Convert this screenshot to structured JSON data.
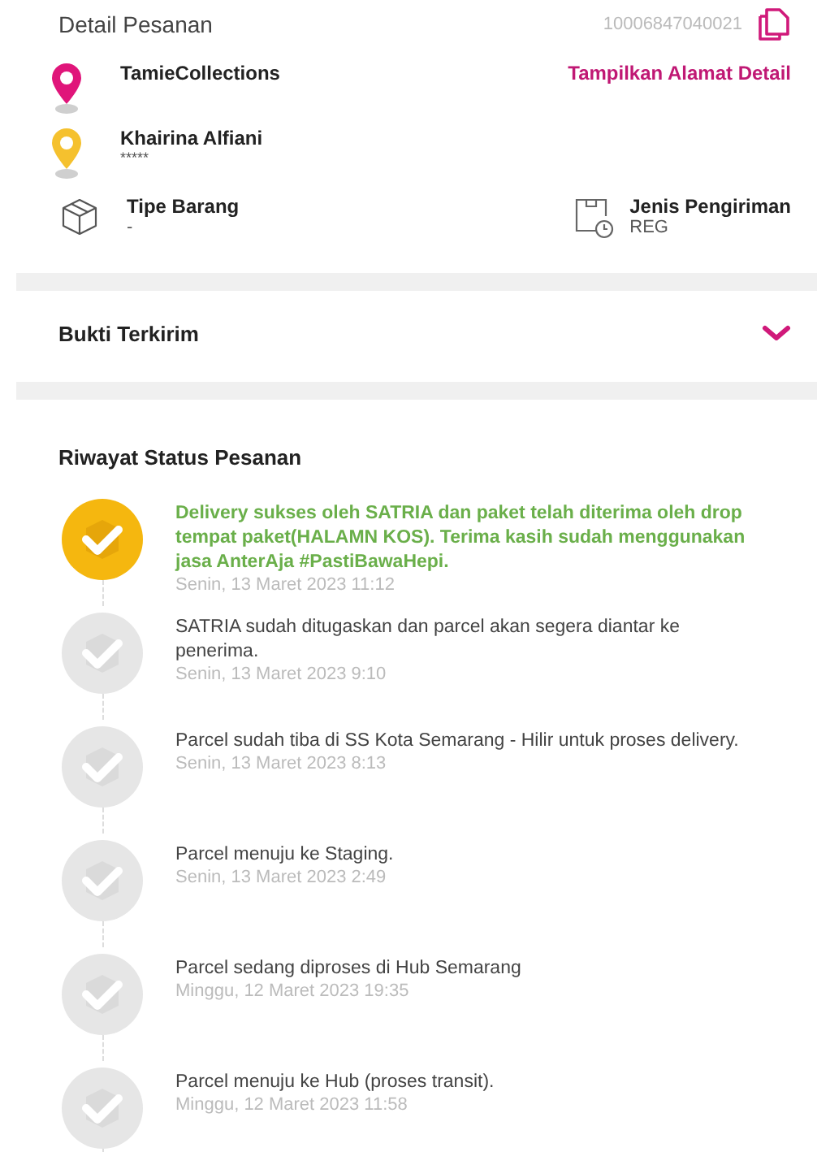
{
  "header": {
    "title": "Detail Pesanan",
    "order_number": "10006847040021"
  },
  "sender": {
    "name": "TamieCollections",
    "link": "Tampilkan Alamat Detail"
  },
  "receiver": {
    "name": "Khairina Alfiani",
    "detail": "*****"
  },
  "item_type": {
    "label": "Tipe Barang",
    "value": "-"
  },
  "shipping_type": {
    "label": "Jenis Pengiriman",
    "value": "REG"
  },
  "proof": {
    "title": "Bukti Terkirim",
    "expanded": false
  },
  "history": {
    "title": "Riwayat Status Pesanan",
    "items": [
      {
        "text": "Delivery sukses oleh SATRIA dan paket telah diterima oleh drop tempat paket(HALAMN KOS). Terima kasih sudah menggunakan jasa AnterAja #PastiBawaHepi.",
        "time": "Senin, 13 Maret 2023 11:12",
        "active": true
      },
      {
        "text": "SATRIA sudah ditugaskan dan parcel akan segera diantar ke penerima.",
        "time": "Senin, 13 Maret 2023 9:10",
        "active": false
      },
      {
        "text": "Parcel sudah tiba di SS Kota Semarang - Hilir untuk proses delivery.",
        "time": "Senin, 13 Maret 2023 8:13",
        "active": false
      },
      {
        "text": "Parcel menuju ke Staging.",
        "time": "Senin, 13 Maret 2023 2:49",
        "active": false
      },
      {
        "text": "Parcel sedang diproses di Hub Semarang",
        "time": "Minggu, 12 Maret 2023 19:35",
        "active": false
      },
      {
        "text": "Parcel menuju ke Hub (proses transit).",
        "time": "Minggu, 12 Maret 2023 11:58",
        "active": false
      }
    ]
  }
}
